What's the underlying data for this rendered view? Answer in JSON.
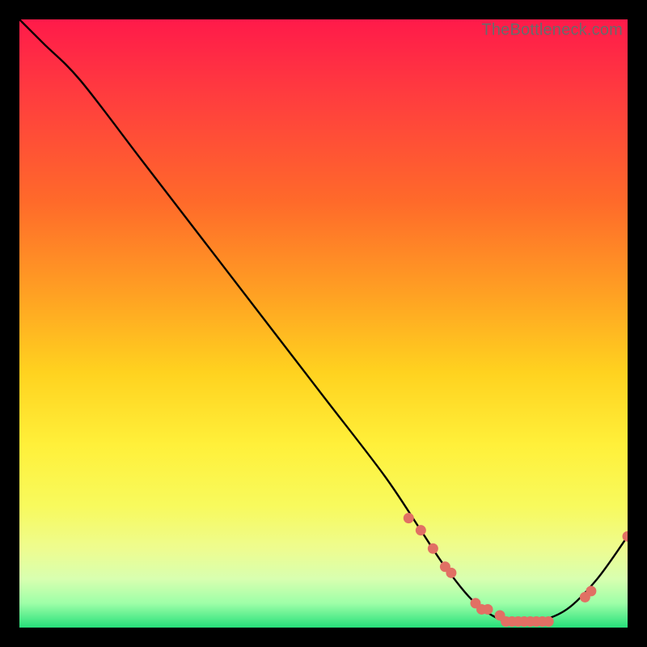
{
  "watermark": "TheBottleneck.com",
  "colors": {
    "gradient_top": "#ff1a4a",
    "gradient_bottom": "#26e07a",
    "curve": "#000000",
    "marker": "#e17064"
  },
  "chart_data": {
    "type": "line",
    "title": "",
    "xlabel": "",
    "ylabel": "",
    "xlim": [
      0,
      100
    ],
    "ylim": [
      0,
      100
    ],
    "series": [
      {
        "name": "curve",
        "x": [
          0,
          4,
          10,
          20,
          30,
          40,
          50,
          60,
          66,
          70,
          75,
          80,
          85,
          90,
          95,
          100
        ],
        "y": [
          100,
          96,
          90,
          77,
          64,
          51,
          38,
          25,
          16,
          10,
          4,
          1,
          1,
          3,
          8,
          15
        ]
      }
    ],
    "markers": {
      "name": "highlighted-points",
      "x": [
        64,
        66,
        68,
        70,
        71,
        75,
        76,
        77,
        79,
        80,
        81,
        82,
        83,
        84,
        85,
        86,
        87,
        93,
        94,
        100
      ],
      "y": [
        18,
        16,
        13,
        10,
        9,
        4,
        3,
        3,
        2,
        1,
        1,
        1,
        1,
        1,
        1,
        1,
        1,
        5,
        6,
        15
      ]
    }
  }
}
